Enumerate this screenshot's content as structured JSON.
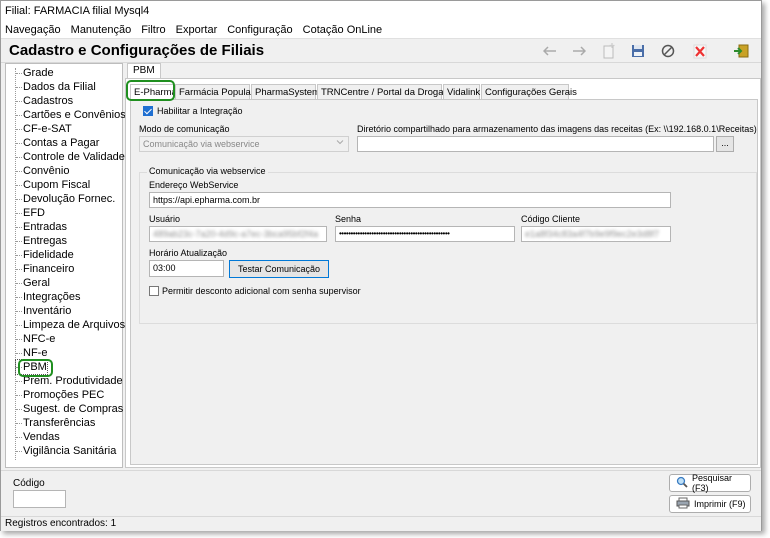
{
  "window_title": "Filial: FARMACIA filial Mysql4",
  "menu": [
    "Navegação",
    "Manutenção",
    "Filtro",
    "Exportar",
    "Configuração",
    "Cotação OnLine"
  ],
  "page_title": "Cadastro e Configurações de Filiais",
  "toolbar_icons": [
    "arrow-left-icon",
    "arrow-right-icon",
    "new-record-icon",
    "save-icon",
    "cancel-icon",
    "delete-icon",
    "exit-icon"
  ],
  "sidebar": {
    "items": [
      "Grade",
      "Dados da Filial",
      "Cadastros",
      "Cartões e Convênios",
      "CF-e-SAT",
      "Contas a Pagar",
      "Controle de Validade",
      "Convênio",
      "Cupom Fiscal",
      "Devolução Fornec.",
      "EFD",
      "Entradas",
      "Entregas",
      "Fidelidade",
      "Financeiro",
      "Geral",
      "Integrações",
      "Inventário",
      "Limpeza de Arquivos",
      "NFC-e",
      "NF-e",
      "PBM",
      "Prem. Produtividade",
      "Promoções PEC",
      "Sugest. de Compras",
      "Transferências",
      "Vendas",
      "Vigilância Sanitária"
    ],
    "selected": "PBM"
  },
  "outer_tab": "PBM",
  "inner_tabs": [
    "E-Pharma",
    "Farmácia Popular",
    "PharmaSystem",
    "TRNCentre / Portal da Drogaria",
    "Vidalink",
    "Configurações Gerais"
  ],
  "form": {
    "habilitar_label": "Habilitar a Integração",
    "habilitar_checked": true,
    "modo_label": "Modo de comunicação",
    "modo_value": "Comunicação via webservice",
    "diretorio_label": "Diretório compartilhado para armazenamento das imagens das receitas (Ex: \\\\192.168.0.1\\Receitas)",
    "diretorio_value": "",
    "browse_label": "...",
    "group_label": "Comunicação via webservice",
    "endereco_label": "Endereço WebService",
    "endereco_value": "https://api.epharma.com.br",
    "usuario_label": "Usuário",
    "usuario_value": "489ab23c-7a20-4d9c-a7ec-3bca95bf2f4a",
    "senha_label": "Senha",
    "senha_value": "••••••••••••••••••••••••••••••••••••••••••••••••",
    "codigo_cliente_label": "Código Cliente",
    "codigo_cliente_value": "e1a8f34c83a4f7b9e9f9ec2e3d8f7",
    "horario_label": "Horário Atualização",
    "horario_value": "03:00",
    "testar_label": "Testar Comunicação",
    "desconto_label": "Permitir desconto adicional com senha supervisor",
    "desconto_checked": false
  },
  "bottom": {
    "codigo_label": "Código",
    "codigo_value": "",
    "pesquisar_label": "Pesquisar (F3)",
    "imprimir_label": "Imprimir (F9)"
  },
  "status": "Registros encontrados: 1",
  "colors": {
    "highlight": "#1f8f1f",
    "checkbox": "#1f6fd1"
  }
}
